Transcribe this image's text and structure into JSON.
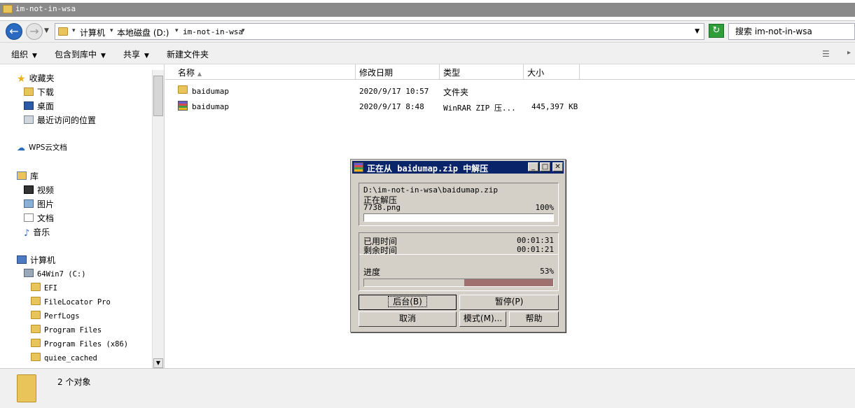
{
  "window": {
    "title": "im-not-in-wsa"
  },
  "address": {
    "crumbs": [
      "计算机",
      "本地磁盘 (D:)",
      "im-not-in-wsa"
    ],
    "search_placeholder": "搜索 im-not-in-wsa"
  },
  "toolbar": {
    "organize": "组织",
    "include_library": "包含到库中",
    "share": "共享",
    "new_folder": "新建文件夹"
  },
  "sidebar": {
    "favorites": "收藏夹",
    "downloads": "下载",
    "desktop": "桌面",
    "recent": "最近访问的位置",
    "wps": "WPS云文档",
    "libraries": "库",
    "videos": "视频",
    "pictures": "图片",
    "documents": "文档",
    "music": "音乐",
    "computer": "计算机",
    "drive_c": "64Win7 (C:)",
    "folders": [
      "EFI",
      "FileLocator Pro",
      "PerfLogs",
      "Program Files",
      "Program Files (x86)",
      "quiee_cached"
    ]
  },
  "columns": {
    "name": "名称",
    "date": "修改日期",
    "type": "类型",
    "size": "大小"
  },
  "files": [
    {
      "name": "baidumap",
      "date": "2020/9/17 10:57",
      "type": "文件夹",
      "size": ""
    },
    {
      "name": "baidumap",
      "date": "2020/9/17 8:48",
      "type": "WinRAR ZIP 压...",
      "size": "445,397 KB"
    }
  ],
  "status": {
    "count": "2 个对象"
  },
  "dialog": {
    "title": "正在从 baidumap.zip 中解压",
    "path": "D:\\im-not-in-wsa\\baidumap.zip",
    "action": "正在解压",
    "current_file": "7738.png",
    "file_percent": "100%",
    "file_progress": 1.0,
    "elapsed_label": "已用时间",
    "elapsed": "00:01:31",
    "remaining_label": "剩余时间",
    "remaining": "00:01:21",
    "progress_label": "进度",
    "total_percent": "53%",
    "total_progress": 0.53,
    "buttons": {
      "background": "后台(B)",
      "pause": "暂停(P)",
      "cancel": "取消",
      "mode": "模式(M)...",
      "help": "帮助"
    },
    "fill_color": "#a0706f"
  }
}
